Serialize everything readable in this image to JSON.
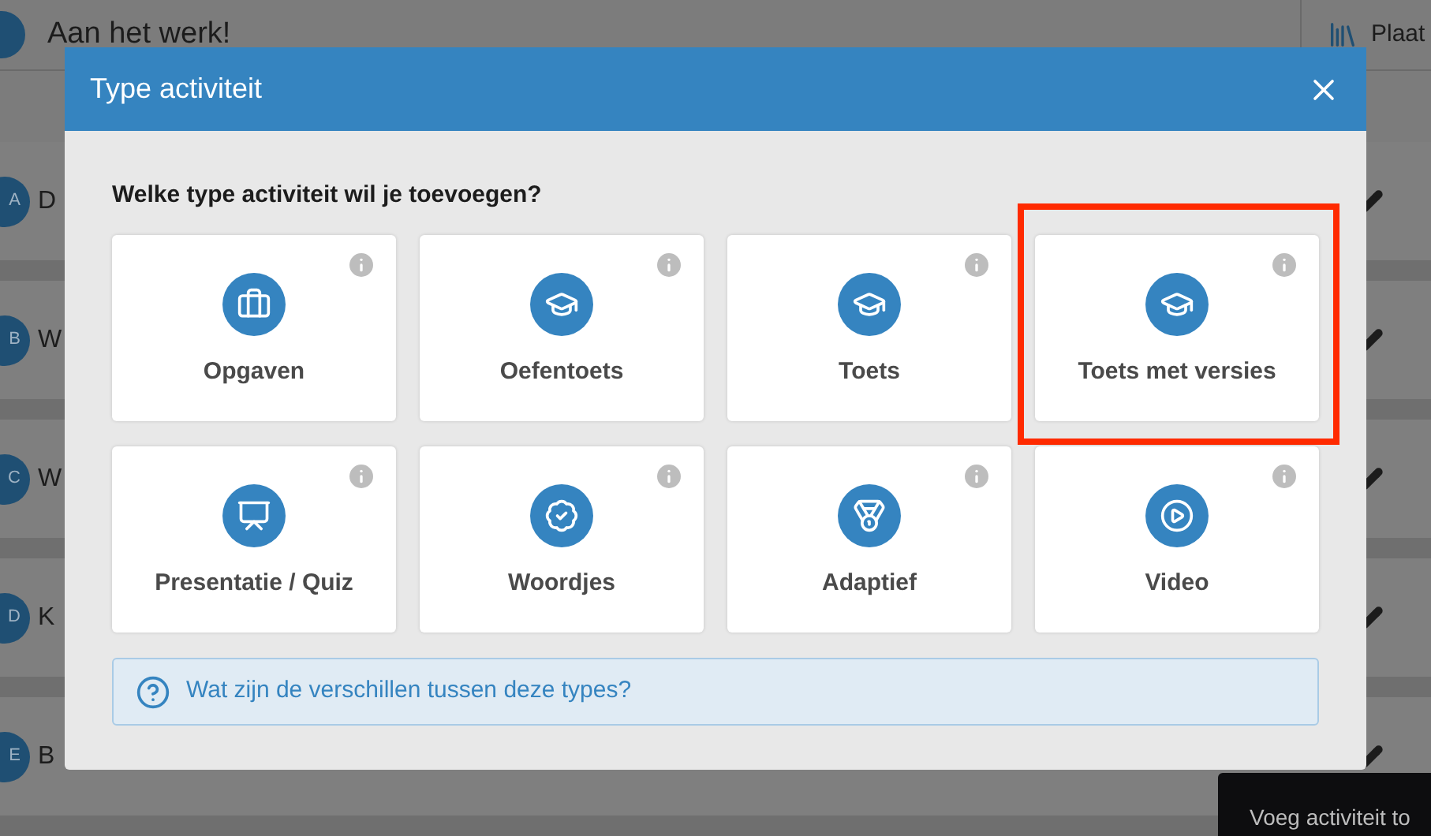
{
  "page": {
    "header_title": "Aan het werk!",
    "header_action": "Plaat",
    "rows": [
      {
        "avatar": "A",
        "name": "D"
      },
      {
        "avatar": "B",
        "name": "W"
      },
      {
        "avatar": "C",
        "name": "W"
      },
      {
        "avatar": "D",
        "name": "K"
      },
      {
        "avatar": "E",
        "name": "B"
      }
    ]
  },
  "dialog": {
    "title": "Type activiteit",
    "question": "Welke type activiteit wil je toevoegen?",
    "cards": [
      {
        "label": "Opgaven",
        "highlighted": false
      },
      {
        "label": "Oefentoets",
        "highlighted": false
      },
      {
        "label": "Toets",
        "highlighted": false
      },
      {
        "label": "Toets met versies",
        "highlighted": true
      },
      {
        "label": "Presentatie / Quiz",
        "highlighted": false
      },
      {
        "label": "Woordjes",
        "highlighted": false
      },
      {
        "label": "Adaptief",
        "highlighted": false
      },
      {
        "label": "Video",
        "highlighted": false
      }
    ],
    "help_link": "Wat zijn de verschillen tussen deze types?"
  },
  "tooltip": "Voeg activiteit to"
}
